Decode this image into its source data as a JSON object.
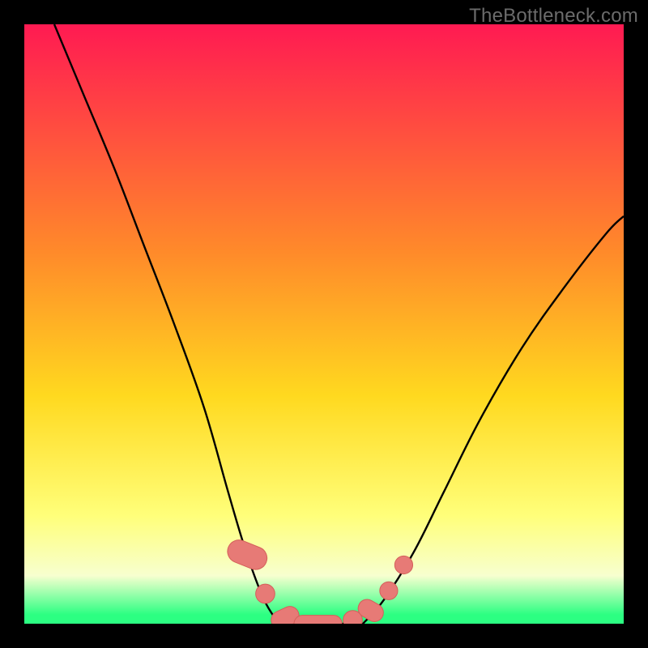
{
  "watermark": {
    "text": "TheBottleneck.com"
  },
  "colors": {
    "frame": "#000000",
    "grad_top": "#ff1a52",
    "grad_mid_upper": "#ff8a2a",
    "grad_mid": "#ffd91f",
    "grad_lower": "#ffff7a",
    "grad_pale": "#f7ffcf",
    "grad_green": "#2cff82",
    "curve": "#000000",
    "marker_fill": "#e77a76",
    "marker_stroke": "#d45f5a"
  },
  "chart_data": {
    "type": "line",
    "title": "",
    "xlabel": "",
    "ylabel": "",
    "xlim": [
      0,
      100
    ],
    "ylim": [
      0,
      100
    ],
    "series": [
      {
        "name": "left-branch",
        "x": [
          5,
          10,
          15,
          20,
          25,
          30,
          34,
          37,
          40,
          42.5
        ],
        "y": [
          100,
          88,
          76,
          63,
          50,
          36,
          22,
          12,
          4,
          0
        ]
      },
      {
        "name": "flat-bottom",
        "x": [
          42.5,
          45,
          48,
          51,
          54,
          56.5
        ],
        "y": [
          0,
          0,
          0,
          0,
          0,
          0
        ]
      },
      {
        "name": "right-branch",
        "x": [
          56.5,
          60,
          65,
          70,
          76,
          83,
          90,
          97,
          100
        ],
        "y": [
          0,
          4,
          12,
          22,
          34,
          46,
          56,
          65,
          68
        ]
      }
    ],
    "markers": [
      {
        "shape": "pill",
        "cx": 37.2,
        "cy": 11.5,
        "rx": 1.9,
        "ry": 3.4,
        "angle": -68
      },
      {
        "shape": "circle",
        "cx": 40.2,
        "cy": 5.0,
        "r": 1.6
      },
      {
        "shape": "pill",
        "cx": 43.5,
        "cy": 1.0,
        "rx": 2.4,
        "ry": 1.5,
        "angle": -25
      },
      {
        "shape": "pill",
        "cx": 49.0,
        "cy": 0.0,
        "rx": 4.0,
        "ry": 1.4,
        "angle": 0
      },
      {
        "shape": "circle",
        "cx": 54.8,
        "cy": 0.6,
        "r": 1.6
      },
      {
        "shape": "pill",
        "cx": 57.8,
        "cy": 2.2,
        "rx": 2.2,
        "ry": 1.5,
        "angle": 30
      },
      {
        "shape": "circle",
        "cx": 60.8,
        "cy": 5.5,
        "r": 1.5
      },
      {
        "shape": "circle",
        "cx": 63.3,
        "cy": 9.8,
        "r": 1.5
      }
    ],
    "gradient_stops": [
      {
        "offset": 0.0,
        "key": "grad_top"
      },
      {
        "offset": 0.38,
        "key": "grad_mid_upper"
      },
      {
        "offset": 0.62,
        "key": "grad_mid"
      },
      {
        "offset": 0.82,
        "key": "grad_lower"
      },
      {
        "offset": 0.92,
        "key": "grad_pale"
      },
      {
        "offset": 0.985,
        "key": "grad_green"
      },
      {
        "offset": 1.0,
        "key": "grad_green"
      }
    ]
  }
}
